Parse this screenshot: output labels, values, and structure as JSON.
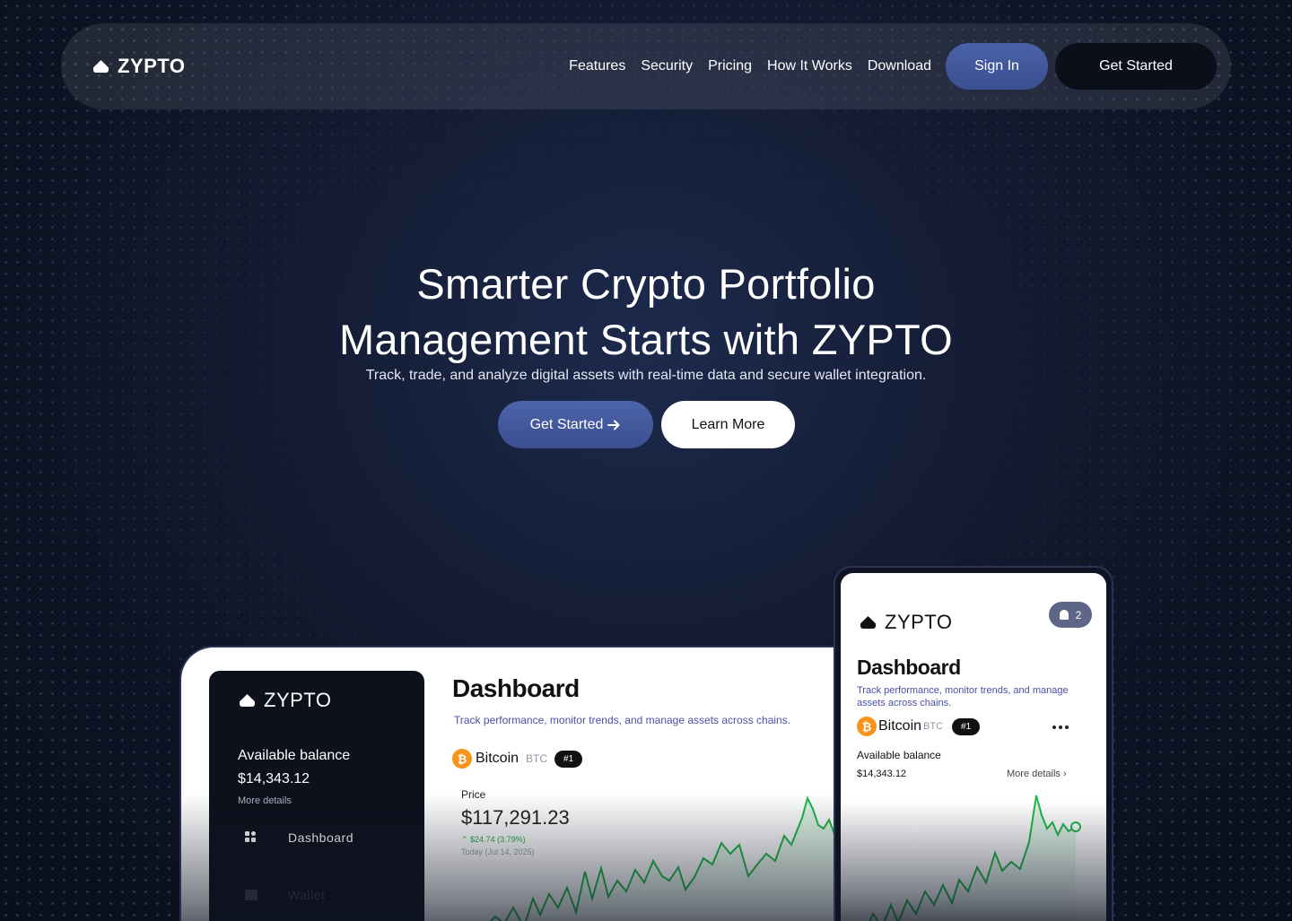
{
  "brand": {
    "name": "ZYPTO"
  },
  "nav": {
    "links": [
      "Features",
      "Security",
      "Pricing",
      "How It Works",
      "Download"
    ],
    "signin_label": "Sign In",
    "getstarted_label": "Get Started"
  },
  "hero": {
    "title_line1": "Smarter Crypto Portfolio",
    "title_line2": "Management Starts with ZYPTO",
    "subtitle": "Track, trade, and analyze digital assets with real-time data and secure wallet integration.",
    "primary_cta": "Get Started",
    "primary_cta_icon": "arrow-right-icon",
    "secondary_cta": "Learn More"
  },
  "desktop_app": {
    "sidebar": {
      "balance_label": "Available balance",
      "balance": "$14,343.12",
      "more_details": "More details",
      "items": [
        {
          "label": "Dashboard",
          "icon": "grid-icon",
          "active": true
        },
        {
          "label": "Wallet",
          "icon": "wallet-icon",
          "active": false
        }
      ]
    },
    "title": "Dashboard",
    "subtitle": "Track performance, monitor trends, and manage assets across chains.",
    "coin": {
      "name": "Bitcoin",
      "ticker": "BTC",
      "rank": "#1",
      "icon_letter": "₿"
    },
    "price_label": "Price",
    "price": "$117,291.23",
    "change": "$24.74 (3.79%)",
    "change_icon": "trend-up-icon",
    "date": "Today (Jul 14, 2025)"
  },
  "mobile_app": {
    "notification_count": "2",
    "title": "Dashboard",
    "subtitle": "Track performance, monitor trends, and manage assets across chains.",
    "coin": {
      "name": "Bitcoin",
      "ticker": "BTC",
      "rank": "#1",
      "icon_letter": "₿"
    },
    "balance_label": "Available balance",
    "balance": "$14,343.12",
    "more_details": "More details",
    "more_icon": "chevron-right-icon"
  },
  "colors": {
    "accent": "#4a62a8",
    "chart_line": "#1fb94a",
    "bitcoin": "#f7931a",
    "subtitle_text": "#4a4fa8"
  }
}
